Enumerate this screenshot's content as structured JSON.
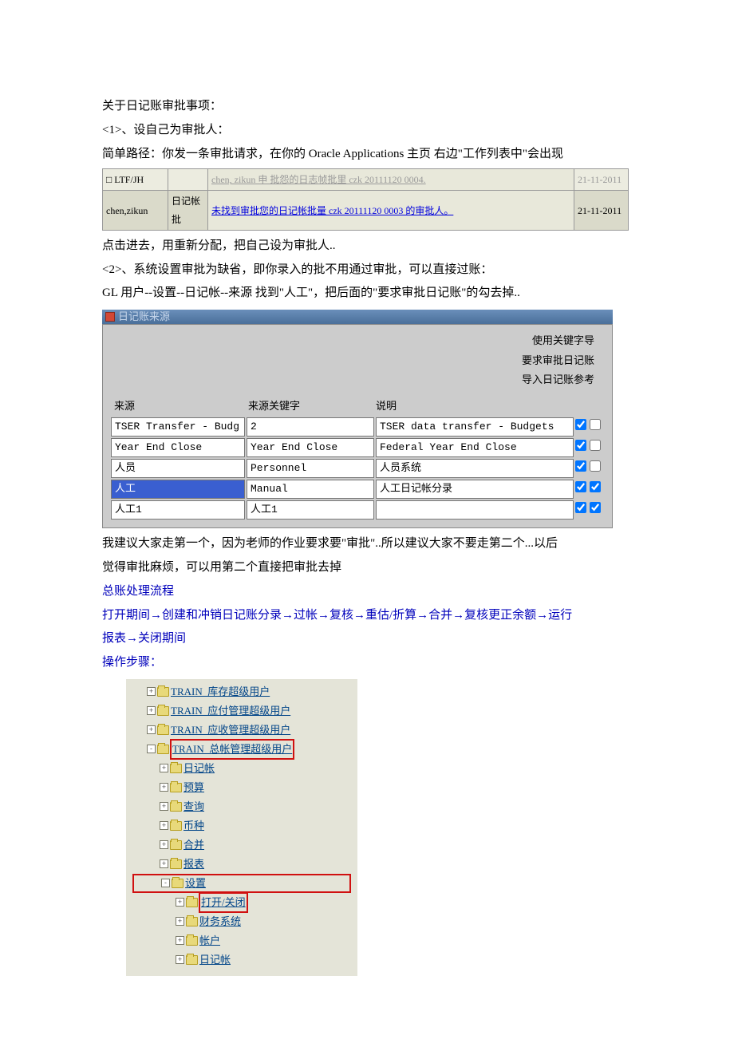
{
  "title_line": "关于日记账审批事项：",
  "item1_head": "<1>、设自己为审批人：",
  "item1_desc": "简单路径：你发一条审批请求，在你的 Oracle Applications 主页 右边\"工作列表中\"会出现",
  "worklist": {
    "rows": [
      {
        "user": "□ LTF/JH",
        "type": "",
        "msg_gray": "chen, zikun 申 批怨的日志帧批里 czk 20111120 0004.",
        "date": "21-11-2011"
      },
      {
        "user": "chen,zikun",
        "type": "日记帐批",
        "msg": "未找到审批您的日记帐批量 czk 20111120 0003 的审批人。",
        "date": "21-11-2011"
      }
    ]
  },
  "after_wl_1": "点击进去，用重新分配，把自己设为审批人..",
  "item2_head": "<2>、系统设置审批为缺省，即你录入的批不用通过审批，可以直接过账：",
  "item2_path": "GL 用户--设置--日记帐--来源     找到\"人工\"，把后面的\"要求审批日记账\"的勾去掉..",
  "oracle": {
    "title": "日记账来源",
    "rlabel1": "使用关键字导",
    "rlabel2": "要求审批日记账",
    "rlabel3": "导入日记账参考",
    "cols": {
      "source": "来源",
      "key": "来源关键字",
      "desc": "说明"
    },
    "rows": [
      {
        "source": "TSER Transfer - Budg",
        "key": "2",
        "desc": "TSER data transfer - Budgets",
        "cb1": true,
        "cb2": false,
        "hl": false
      },
      {
        "source": "Year End Close",
        "key": "Year End Close",
        "desc": "Federal Year End Close",
        "cb1": true,
        "cb2": false,
        "hl": false
      },
      {
        "source": "人员",
        "key": "Personnel",
        "desc": "人员系统",
        "cb1": true,
        "cb2": false,
        "hl": false
      },
      {
        "source": "人工",
        "key": "Manual",
        "desc": "人工日记帐分录",
        "cb1": true,
        "cb2": true,
        "hl": true
      },
      {
        "source": "人工1",
        "key": "人工1",
        "desc": "",
        "cb1": true,
        "cb2": true,
        "hl": false
      }
    ]
  },
  "advice_1": "我建议大家走第一个，因为老师的作业要求要\"审批\"..所以建议大家不要走第二个...以后",
  "advice_2": "觉得审批麻烦，可以用第二个直接把审批去掉",
  "section_flow_title": "总账处理流程",
  "section_flow_1": "打开期间→创建和冲销日记账分录→过帐→复核→重估/折算→合并→复核更正余额→运行",
  "section_flow_2": "报表→关闭期间",
  "steps_title": "操作步骤：",
  "tree": {
    "items": [
      {
        "level": "l1",
        "exp": "+",
        "label": "TRAIN_库存超级用户",
        "link": true
      },
      {
        "level": "l1",
        "exp": "+",
        "label": "TRAIN_应付管理超级用户",
        "link": true
      },
      {
        "level": "l1",
        "exp": "+",
        "label": "TRAIN_应收管理超级用户",
        "link": true
      },
      {
        "level": "l1",
        "exp": "-",
        "label": "TRAIN_总帐管理超级用户",
        "link": true,
        "red": true
      },
      {
        "level": "l2",
        "exp": "+",
        "label": "日记帐",
        "link": true
      },
      {
        "level": "l2",
        "exp": "+",
        "label": "预算",
        "link": true
      },
      {
        "level": "l2",
        "exp": "+",
        "label": "查询",
        "link": true
      },
      {
        "level": "l2",
        "exp": "+",
        "label": "币种",
        "link": true
      },
      {
        "level": "l2",
        "exp": "+",
        "label": "合并",
        "link": true
      },
      {
        "level": "l2",
        "exp": "+",
        "label": "报表",
        "link": true
      },
      {
        "level": "l2",
        "exp": "-",
        "label": "设置",
        "link": true,
        "redrow": true
      },
      {
        "level": "l3",
        "exp": "+",
        "label": "打开/关闭",
        "link": true,
        "red": true
      },
      {
        "level": "l3",
        "exp": "+",
        "label": "财务系统",
        "link": true
      },
      {
        "level": "l3",
        "exp": "+",
        "label": "帐户",
        "link": true
      },
      {
        "level": "l3",
        "exp": "+",
        "label": "日记帐",
        "link": true
      }
    ]
  }
}
